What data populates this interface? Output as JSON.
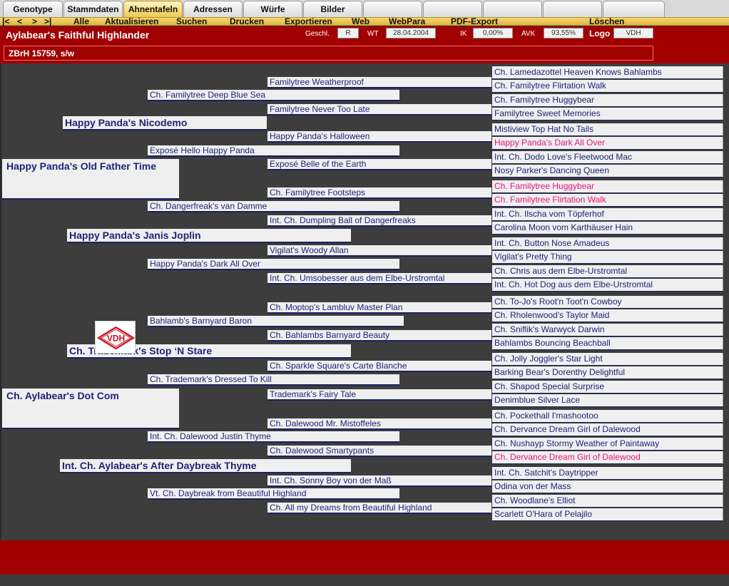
{
  "tabs": [
    "Genotype",
    "Stammdaten",
    "Ahnentafeln",
    "Adressen",
    "Würfe",
    "Bilder"
  ],
  "nav_arrows": [
    "|<",
    "<",
    ">",
    ">|"
  ],
  "menu": [
    "Alle",
    "Aktualisieren",
    "Suchen",
    "Drucken",
    "Exportieren",
    "Web",
    "WebPara",
    "PDF-Export",
    "Löschen"
  ],
  "header": {
    "dog_name": "Aylabear's Faithful Highlander",
    "sub": "ZBrH 15759, s/w",
    "gesch_label": "Geschl.",
    "gesch_value": "R",
    "wt_label": "WT",
    "wt_value": "28.04.2004",
    "ik_label": "IK",
    "ik_value": "0,00%",
    "avk_label": "AVK",
    "avk_value": "93,55%",
    "logo_label": "Logo",
    "logo_value": "VDH"
  },
  "logo_text": "VDH",
  "colors": {
    "header_red": "#a10000",
    "highlight": "#e8157a",
    "name_blue": "#1e2478",
    "tab_active": "#f0c850"
  },
  "pedigree": {
    "g1": [
      "Happy Panda's Old Father Time",
      "Ch. Aylabear's Dot Com"
    ],
    "g2": [
      "Happy Panda's Nicodemo",
      "Happy Panda's Janis Joplin",
      "Ch. Trademark's Stop ‘N Stare",
      "Int. Ch. Aylabear's After Daybreak Thyme"
    ],
    "g3": [
      "Ch. Familytree Deep Blue Sea",
      "Exposé Hello Happy Panda",
      "Ch. Dangerfreak's van Damme",
      "Happy Panda's Dark All Over",
      "Bahlamb's Barnyard Baron",
      "Ch. Trademark's Dressed To Kill",
      "Int. Ch. Dalewood Justin Thyme",
      "Vt. Ch. Daybreak from Beautiful Highland"
    ],
    "g4": [
      "Familytree Weatherproof",
      "Familytree Never Too Late",
      "Happy Panda's Halloween",
      "Exposé Belle of the Earth",
      "Ch. Familytree Footsteps",
      "Int. Ch. Dumpling Ball of Dangerfreaks",
      "Vigilat's Woody Allan",
      "Int. Ch. Umsobesser aus dem Elbe-Urstromtal",
      "Ch. Moptop's Lambluv Master Plan",
      "Ch. Bahlambs Barnyard Beauty",
      "Ch. Sparkle Square's Carte Blanche",
      "Trademark's Fairy Tale",
      "Ch. Dalewood Mr. Mistoffeles",
      "Ch. Dalewood Smartypants",
      "Int. Ch. Sonny Boy von der Maß",
      "Ch. All my Dreams from Beautiful Highland"
    ],
    "g5": [
      {
        "name": "Ch. Lamedazottel Heaven Knows Bahlambs",
        "hl": false
      },
      {
        "name": "Ch. Familytree Flirtation Walk",
        "hl": false
      },
      {
        "name": "Ch. Familytree Huggybear",
        "hl": false
      },
      {
        "name": "Familytree Sweet Memories",
        "hl": false
      },
      {
        "name": "Mistiview Top Hat No Tails",
        "hl": false
      },
      {
        "name": "Happy Panda's Dark All Over",
        "hl": true
      },
      {
        "name": "Int. Ch. Dodo Love's Fleetwood Mac",
        "hl": false
      },
      {
        "name": "Nosy Parker's Dancing Queen",
        "hl": false
      },
      {
        "name": "Ch. Familytree Huggybear",
        "hl": true
      },
      {
        "name": "Ch. Familytree Flirtation Walk",
        "hl": true
      },
      {
        "name": "Int. Ch. Ilscha vom Töpferhof",
        "hl": false
      },
      {
        "name": "Carolina Moon vom Karthäuser Hain",
        "hl": false
      },
      {
        "name": "Int. Ch. Button Nose Amadeus",
        "hl": false
      },
      {
        "name": "Vigilat's Pretty Thing",
        "hl": false
      },
      {
        "name": "Ch. Chris aus dem Elbe-Urstromtal",
        "hl": false
      },
      {
        "name": "Int. Ch. Hot Dog aus dem Elbe-Urstromtal",
        "hl": false
      },
      {
        "name": "Ch. To-Jo's Root'n Toot'n Cowboy",
        "hl": false
      },
      {
        "name": "Ch. Rholenwood's Taylor Maid",
        "hl": false
      },
      {
        "name": "Ch. Sniflik's Warwyck Darwin",
        "hl": false
      },
      {
        "name": "Bahlambs Bouncing Beachball",
        "hl": false
      },
      {
        "name": "Ch. Jolly Joggler's Star Light",
        "hl": false
      },
      {
        "name": "Barking Bear's Dorenthy Delightful",
        "hl": false
      },
      {
        "name": "Ch. Shapod Special Surprise",
        "hl": false
      },
      {
        "name": "Denimblue Silver Lace",
        "hl": false
      },
      {
        "name": "Ch. Pockethall I'mashootoo",
        "hl": false
      },
      {
        "name": "Ch. Dervance Dream Girl of Dalewood",
        "hl": false
      },
      {
        "name": "Ch. Nushayp Stormy Weather of Paintaway",
        "hl": false
      },
      {
        "name": "Ch. Dervance Dream Girl of Dalewood",
        "hl": true
      },
      {
        "name": "Int. Ch. Satchit's Daytripper",
        "hl": false
      },
      {
        "name": "Odina von der Mass",
        "hl": false
      },
      {
        "name": "Ch. Woodlane's Elliot",
        "hl": false
      },
      {
        "name": "Scarlett O'Hara of Pelajilo",
        "hl": false
      }
    ]
  }
}
